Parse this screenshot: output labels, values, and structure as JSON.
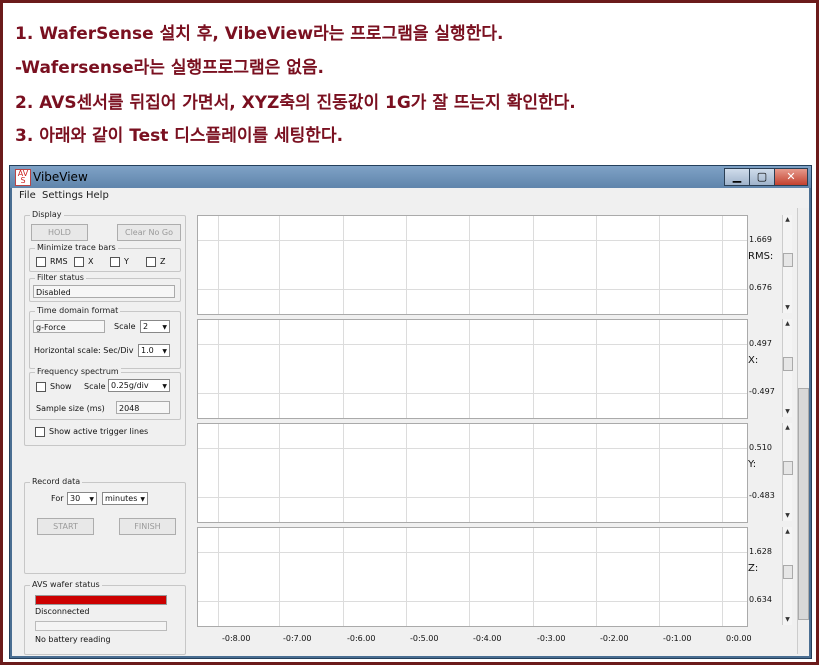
{
  "instructions": [
    "1. WaferSense 설치 후, VibeView라는 프로그램을 실행한다.",
    "-Wafersense라는 실행프로그램은 없음.",
    "2. AVS센서를 뒤집어 가면서, XYZ축의 진동값이 1G가 잘 뜨는지 확인한다.",
    "3. 아래와 같이 Test 디스플레이를 세팅한다."
  ],
  "window": {
    "title": "VibeView",
    "minimize": "▁",
    "maximize": "▢",
    "close": "✕"
  },
  "menu": [
    "File",
    "Settings",
    "Help"
  ],
  "display": {
    "legend": "Display",
    "hold": "HOLD",
    "clear_no_go": "Clear No Go",
    "minimize_legend": "Minimize trace bars",
    "minimize_options": [
      "RMS",
      "X",
      "Y",
      "Z"
    ],
    "filter_legend": "Filter status",
    "filter_value": "Disabled",
    "time_legend": "Time domain format",
    "time_mode": "g-Force",
    "scale_label": "Scale",
    "scale_value": "2",
    "hscale_label": "Horizontal scale: Sec/Div",
    "hscale_value": "1.0",
    "freq_legend": "Frequency spectrum",
    "show_label": "Show",
    "freq_scale_label": "Scale",
    "freq_scale_value": "0.25g/div",
    "sample_label": "Sample size (ms)",
    "sample_value": "2048",
    "trigger_label": "Show active trigger lines"
  },
  "record": {
    "legend": "Record data",
    "for_label": "For",
    "for_value": "30",
    "unit_value": "minutes",
    "start": "START",
    "finish": "FINISH"
  },
  "avs": {
    "legend": "AVS wafer status",
    "status": "Disconnected",
    "battery": "No battery reading",
    "status_color": "#cc0000"
  },
  "plots": [
    {
      "axis": "RMS:",
      "top": "1.669",
      "bottom": "0.676"
    },
    {
      "axis": "X:",
      "top": "0.497",
      "bottom": "-0.497"
    },
    {
      "axis": "Y:",
      "top": "0.510",
      "bottom": "-0.483"
    },
    {
      "axis": "Z:",
      "top": "1.628",
      "bottom": "0.634"
    }
  ],
  "x_ticks": [
    "-0:8.00",
    "-0:7.00",
    "-0:6.00",
    "-0:5.00",
    "-0:4.00",
    "-0:3.00",
    "-0:2.00",
    "-0:1.00",
    "0:0.00"
  ]
}
